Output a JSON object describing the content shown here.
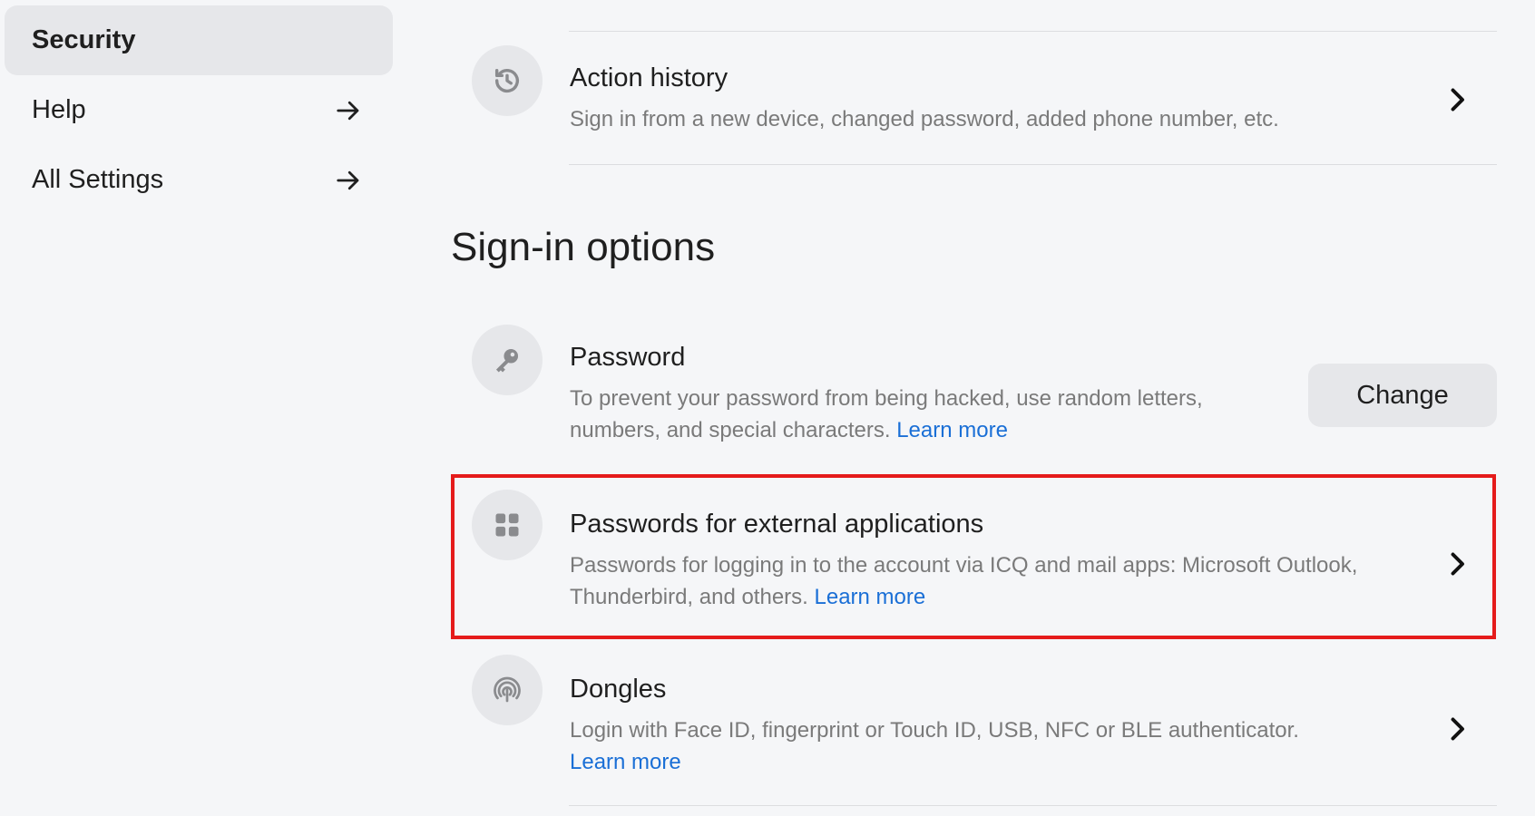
{
  "sidebar": {
    "items": [
      {
        "label": "Security",
        "active": true
      },
      {
        "label": "Help"
      },
      {
        "label": "All Settings"
      }
    ]
  },
  "action_history": {
    "title": "Action history",
    "description": "Sign in from a new device, changed password, added phone number, etc.",
    "icon": "history-icon"
  },
  "sign_in_options": {
    "heading": "Sign-in options",
    "password": {
      "title": "Password",
      "description": "To prevent your password from being hacked, use random letters, numbers, and special characters.",
      "learn_more": "Learn more",
      "button": "Change",
      "icon": "key-icon"
    },
    "external_apps": {
      "title": "Passwords for external applications",
      "description": "Passwords for logging in to the account via ICQ and mail apps: Microsoft Outlook, Thunderbird, and others.",
      "learn_more": "Learn more",
      "icon": "apps-grid-icon"
    },
    "dongles": {
      "title": "Dongles",
      "description": "Login with Face ID, fingerprint or Touch ID, USB, NFC or BLE authenticator.",
      "learn_more": "Learn more",
      "icon": "fingerprint-icon"
    }
  },
  "colors": {
    "background": "#f5f6f8",
    "link": "#1a6fd6",
    "highlight": "#e51b1b",
    "muted_text": "#7a7a7a"
  }
}
